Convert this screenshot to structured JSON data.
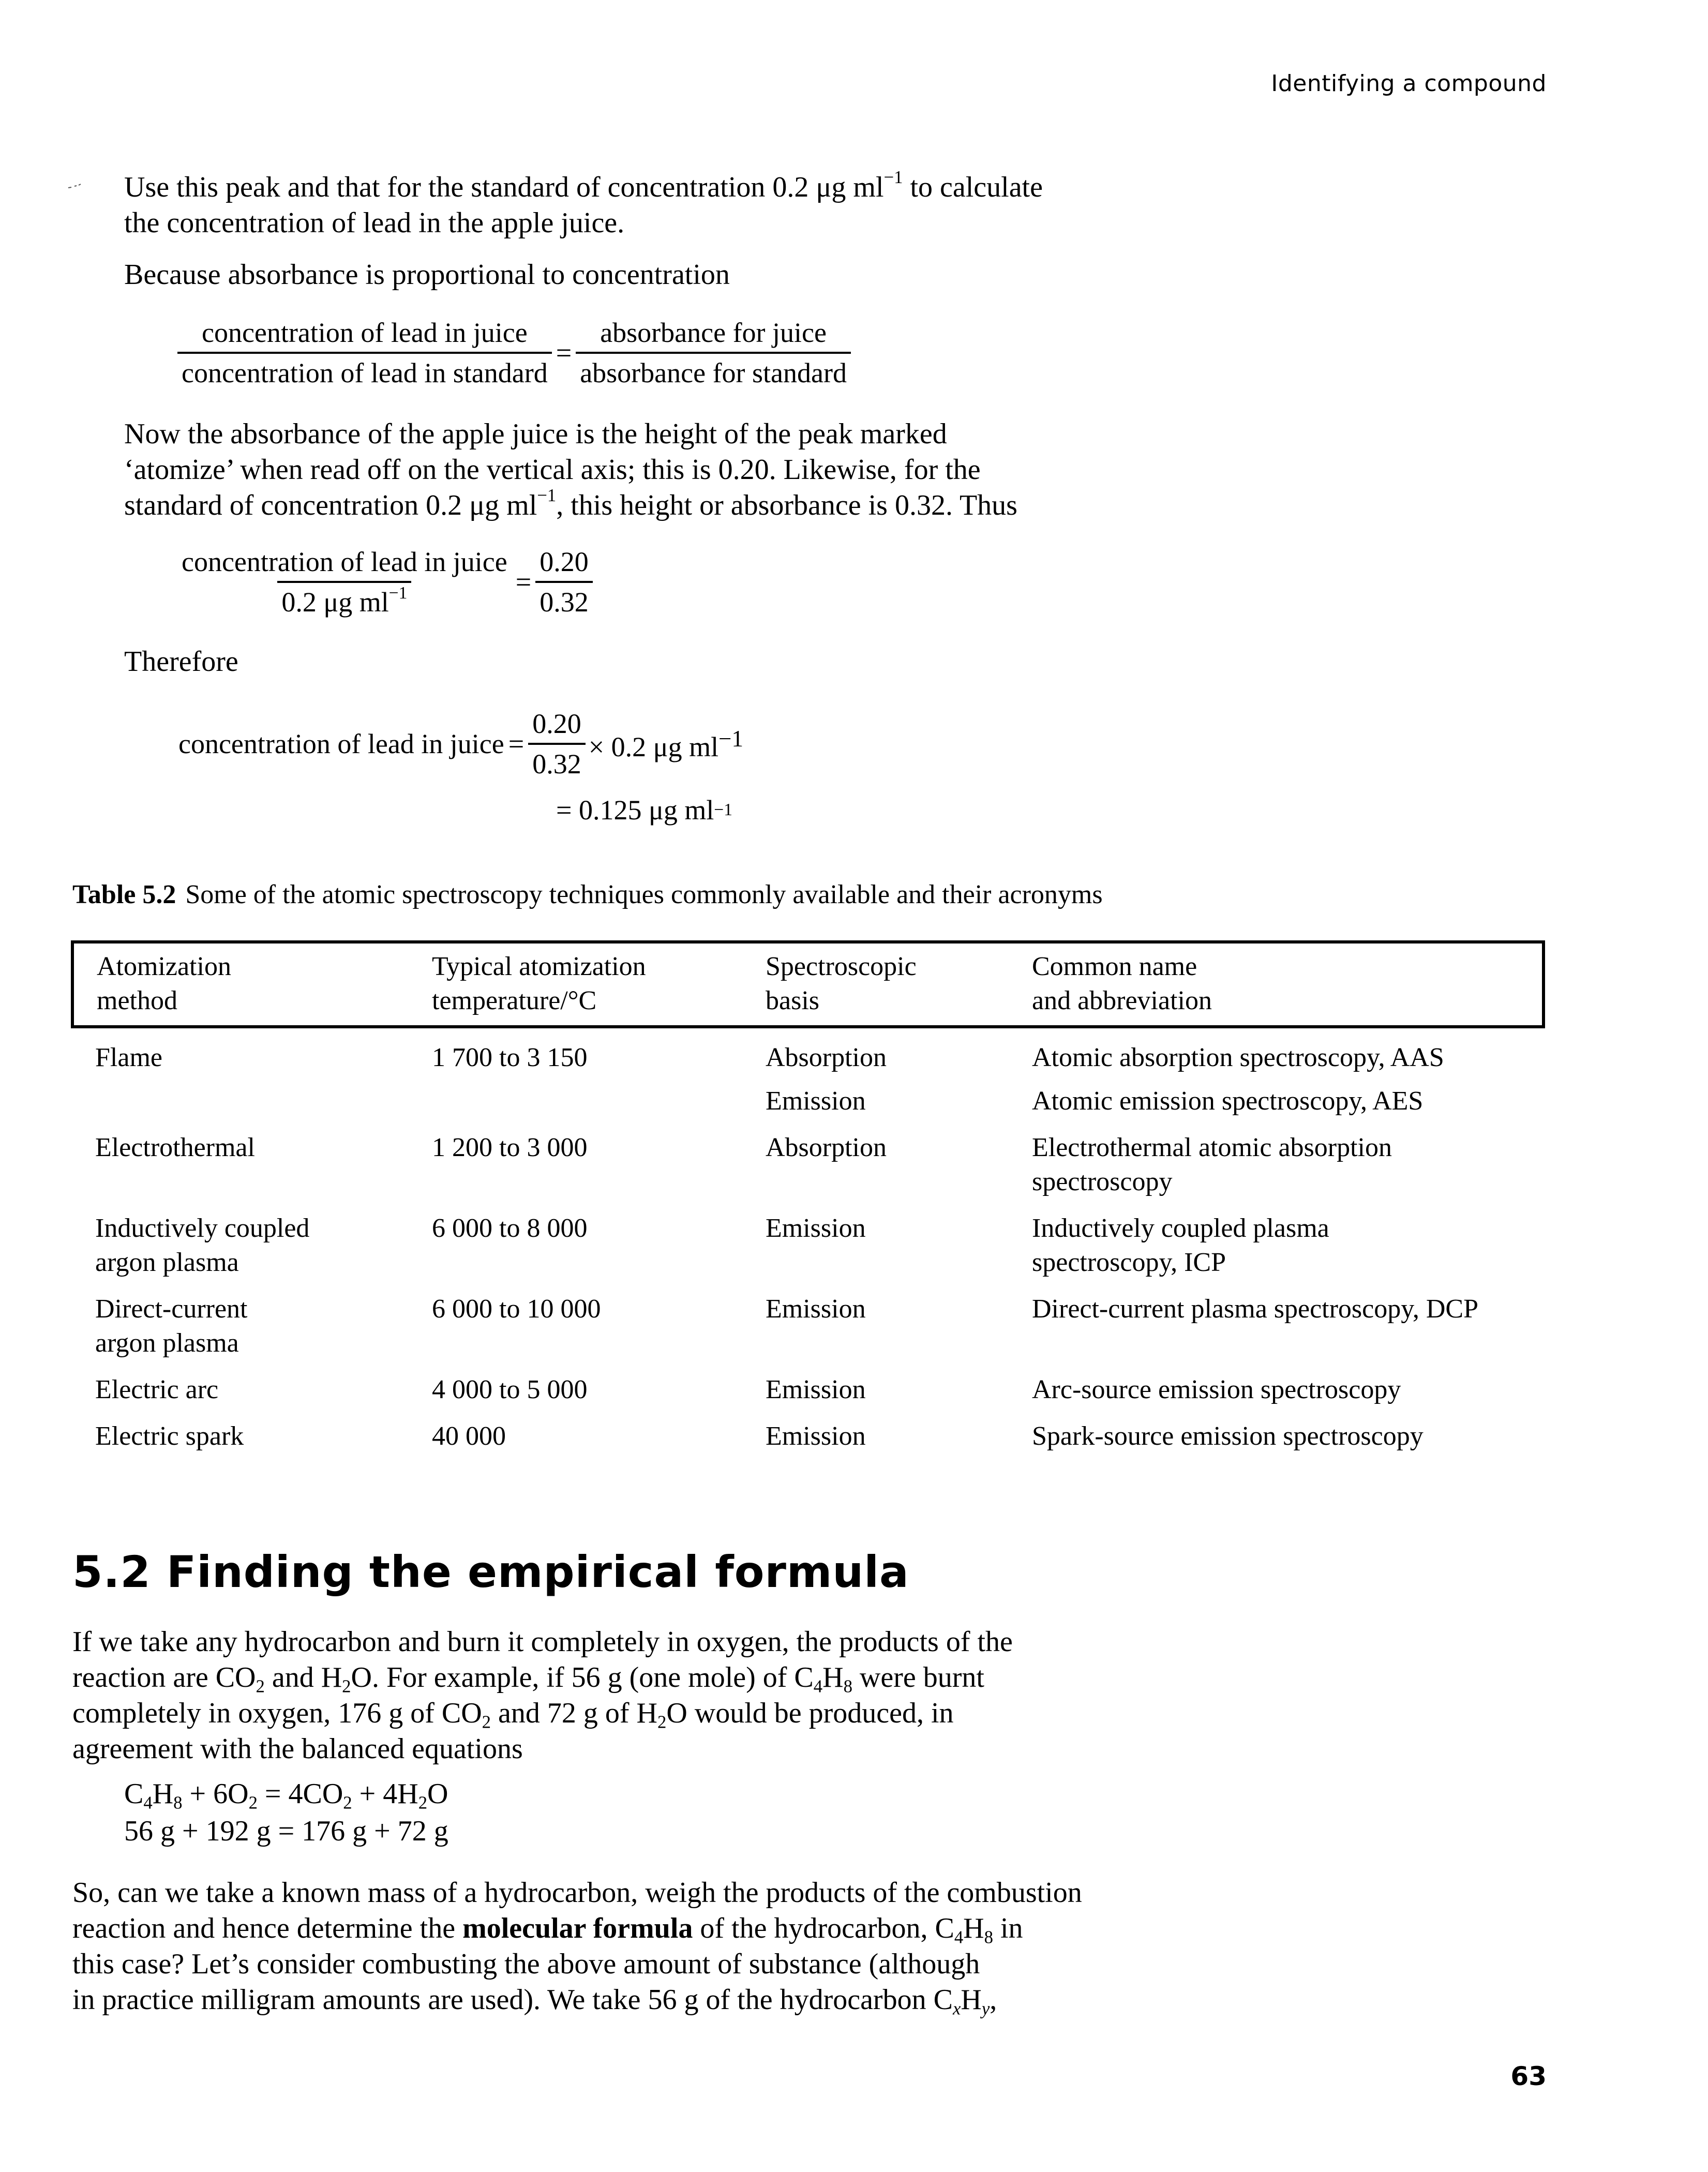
{
  "running_header": "Identifying a compound",
  "page_number": "63",
  "intro": {
    "line1_pre": "Use this peak and that for the standard of concentration 0.2 μg ml",
    "line1_sup": "−1",
    "line1_post": " to calculate",
    "line2": "the concentration of lead in the apple juice.",
    "because": "Because absorbance is proportional to concentration"
  },
  "ratio_equation": {
    "lhs_num": "concentration of lead in juice",
    "lhs_den": "concentration of lead in standard",
    "equals": "=",
    "rhs_num": "absorbance for juice",
    "rhs_den": "absorbance for standard"
  },
  "now_paragraph": {
    "line1": "Now the absorbance of the apple juice is the height of the peak marked",
    "line2": "‘atomize’ when read off on the vertical axis; this is 0.20. Likewise, for the",
    "line3_pre": "standard of concentration 0.2 μg ml",
    "line3_sup": "−1",
    "line3_post": ", this height or absorbance is 0.32. Thus"
  },
  "values_equation": {
    "lhs_num": "concentration of lead in juice",
    "lhs_den_pre": "0.2 μg ml",
    "lhs_den_sup": "−1",
    "equals": "=",
    "rhs_num": "0.20",
    "rhs_den": "0.32"
  },
  "therefore": "Therefore",
  "result_equation": {
    "lhs": "concentration of lead in juice",
    "equals": "=",
    "frac_num": "0.20",
    "frac_den": "0.32",
    "times_pre": "× 0.2 μg ml",
    "times_sup": "−1",
    "result_pre": "= 0.125 μg ml",
    "result_sup": "−1"
  },
  "table": {
    "caption_label": "Table 5.2",
    "caption_text": "Some of the atomic spectroscopy techniques commonly available and their acronyms",
    "headers": [
      [
        "Atomization",
        "method"
      ],
      [
        "Typical atomization",
        "temperature/°C"
      ],
      [
        "Spectroscopic",
        "basis"
      ],
      [
        "Common name",
        "and abbreviation"
      ]
    ],
    "rows": [
      {
        "method": [
          "Flame"
        ],
        "temperature": "1 700 to 3 150",
        "basis": "Absorption",
        "name": [
          "Atomic absorption spectroscopy, AAS"
        ]
      },
      {
        "method": [
          ""
        ],
        "temperature": "",
        "basis": "Emission",
        "name": [
          "Atomic emission spectroscopy, AES"
        ]
      },
      {
        "method": [
          "Electrothermal"
        ],
        "temperature": "1 200 to 3 000",
        "basis": "Absorption",
        "name": [
          "Electrothermal atomic absorption",
          "spectroscopy"
        ]
      },
      {
        "method": [
          "Inductively coupled",
          "argon plasma"
        ],
        "temperature": "6 000 to 8 000",
        "basis": "Emission",
        "name": [
          "Inductively coupled plasma",
          "spectroscopy, ICP"
        ]
      },
      {
        "method": [
          "Direct-current",
          "argon plasma"
        ],
        "temperature": "6 000 to 10 000",
        "basis": "Emission",
        "name": [
          "Direct-current plasma spectroscopy, DCP"
        ]
      },
      {
        "method": [
          "Electric arc"
        ],
        "temperature": "4 000 to 5 000",
        "basis": "Emission",
        "name": [
          "Arc-source emission spectroscopy"
        ]
      },
      {
        "method": [
          "Electric spark"
        ],
        "temperature": "40 000",
        "basis": "Emission",
        "name": [
          "Spark-source emission spectroscopy"
        ]
      }
    ]
  },
  "section": {
    "number": "5.2",
    "title": "Finding the empirical formula"
  },
  "combustion_paragraph": {
    "l1": "If we take any hydrocarbon and burn it completely in oxygen, the products of the",
    "l2_a": "reaction are CO",
    "l2_b": "2",
    "l2_c": " and H",
    "l2_d": "2",
    "l2_e": "O. For example, if 56 g (one mole) of C",
    "l2_f": "4",
    "l2_g": "H",
    "l2_h": "8",
    "l2_i": " were burnt",
    "l3_a": "completely in oxygen, 176 g of CO",
    "l3_b": "2",
    "l3_c": " and 72 g of H",
    "l3_d": "2",
    "l3_e": "O would be produced, in",
    "l4": "agreement with the balanced equations"
  },
  "balanced_equations": {
    "eq1": {
      "a": "C",
      "b": "4",
      "c": "H",
      "d": "8",
      "e": " + 6O",
      "f": "2",
      "g": " = 4CO",
      "h": "2",
      "i": " + 4H",
      "j": "2",
      "k": "O"
    },
    "eq2": "56 g + 192 g = 176 g + 72 g"
  },
  "question_paragraph": {
    "l1": "So, can we take a known mass of a hydrocarbon, weigh the products of the combustion",
    "l2_a": "reaction and hence determine the ",
    "l2_bold": "molecular formula",
    "l2_b": " of the hydrocarbon, C",
    "l2_c": "4",
    "l2_d": "H",
    "l2_e": "8",
    "l2_f": " in",
    "l3": "this case? Let’s consider combusting the above amount of substance (although",
    "l4_a": "in practice milligram amounts are used). We take 56 g of the hydrocarbon C",
    "l4_b": "x",
    "l4_c": "H",
    "l4_d": "y",
    "l4_e": ","
  }
}
